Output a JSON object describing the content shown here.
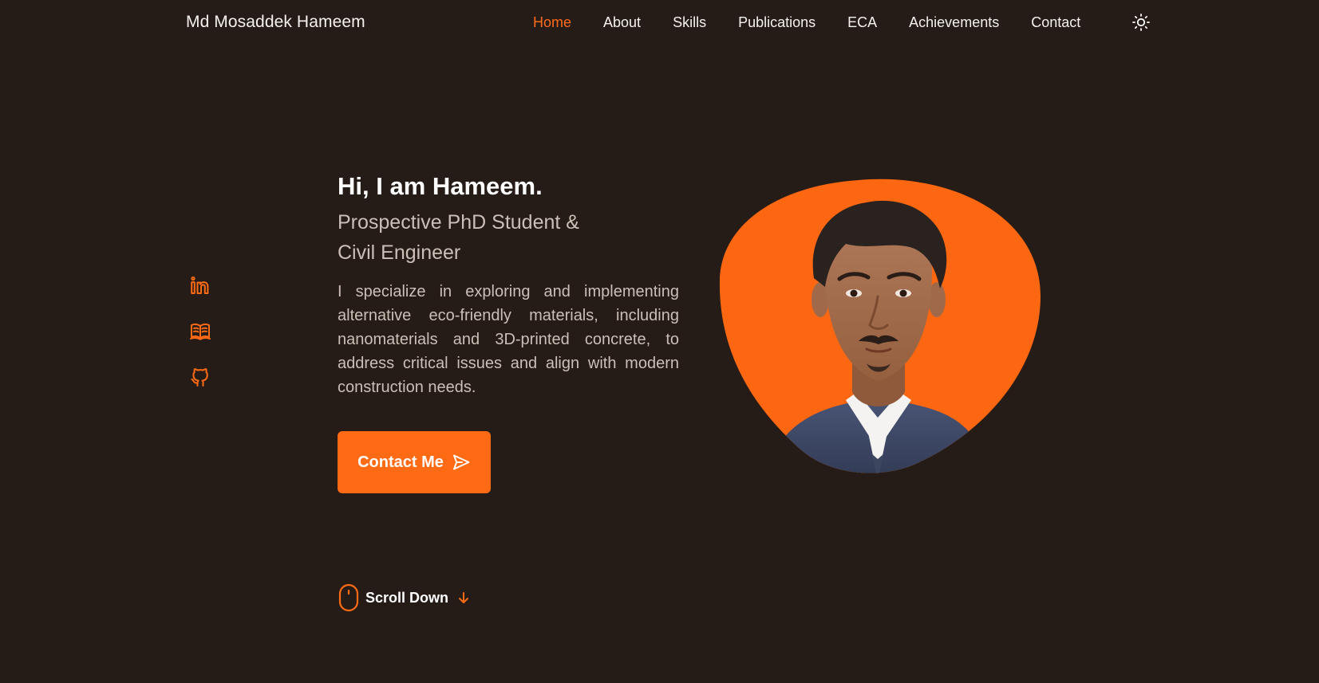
{
  "header": {
    "brand": "Md Mosaddek Hameem",
    "nav": [
      {
        "label": "Home",
        "active": true
      },
      {
        "label": "About",
        "active": false
      },
      {
        "label": "Skills",
        "active": false
      },
      {
        "label": "Publications",
        "active": false
      },
      {
        "label": "ECA",
        "active": false
      },
      {
        "label": "Achievements",
        "active": false
      },
      {
        "label": "Contact",
        "active": false
      }
    ],
    "theme_toggle_icon": "sun-icon"
  },
  "social": [
    {
      "name": "linkedin",
      "icon": "linkedin-icon"
    },
    {
      "name": "publications",
      "icon": "book-icon"
    },
    {
      "name": "github",
      "icon": "github-icon"
    }
  ],
  "hero": {
    "title": "Hi, I am Hameem.",
    "subtitle_line1": "Prospective PhD Student &",
    "subtitle_line2": "Civil Engineer",
    "description": "I specialize in exploring and implementing alternative eco-friendly materials, including nanomaterials and 3D-printed concrete, to address critical issues and align with modern construction needs.",
    "cta_label": "Contact Me",
    "cta_icon": "send-icon",
    "scroll_label": "Scroll Down",
    "scroll_icon": "mouse-icon",
    "scroll_arrow_icon": "arrow-down-icon"
  },
  "colors": {
    "background": "#261c17",
    "accent": "#ff6a14",
    "text_primary": "#ffffff",
    "text_secondary": "#cbbfb7"
  }
}
